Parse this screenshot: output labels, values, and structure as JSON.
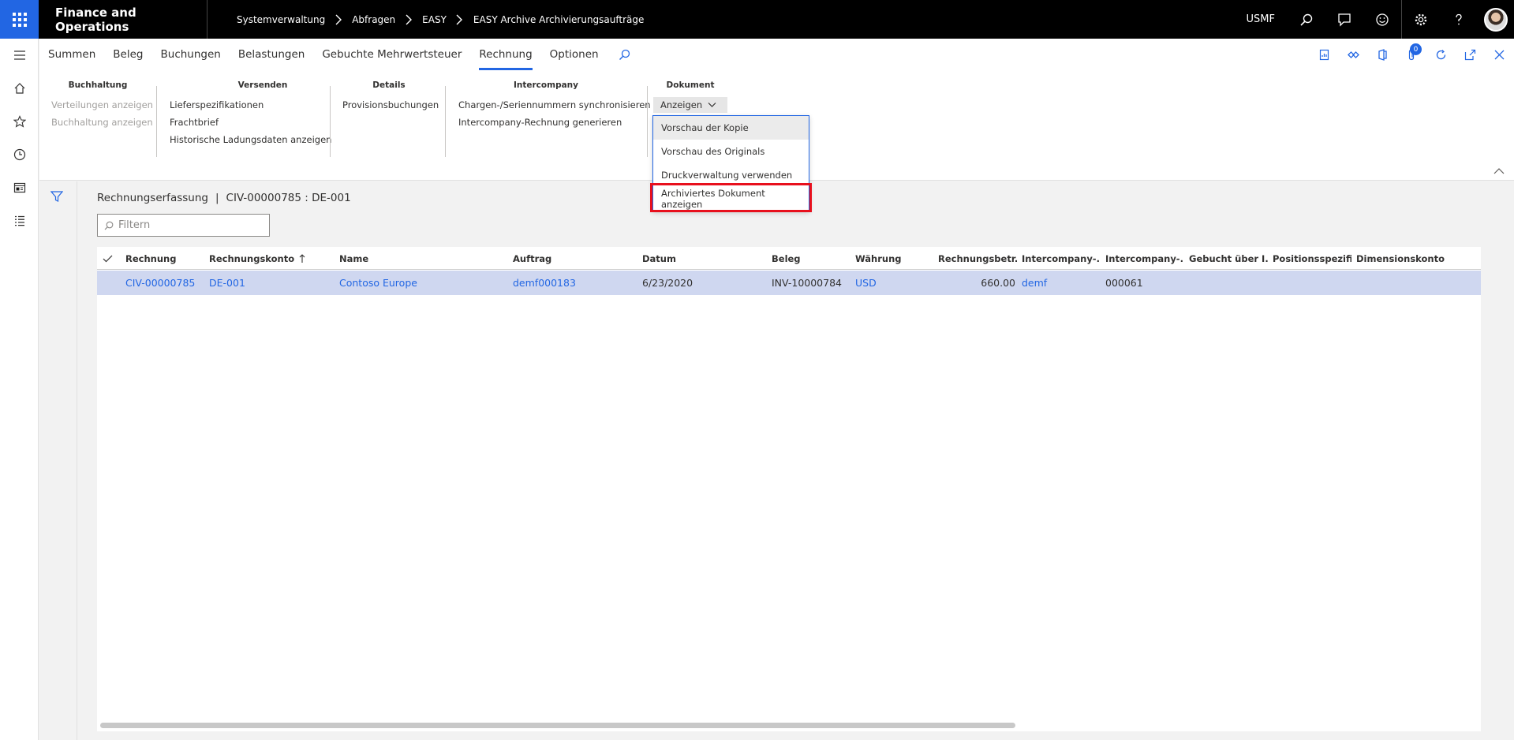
{
  "app": {
    "title": "Finance and Operations"
  },
  "breadcrumbs": [
    "Systemverwaltung",
    "Abfragen",
    "EASY",
    "EASY Archive Archivierungsaufträge"
  ],
  "topbar": {
    "company": "USMF"
  },
  "tabs": [
    "Summen",
    "Beleg",
    "Buchungen",
    "Belastungen",
    "Gebuchte Mehrwertsteuer",
    "Rechnung",
    "Optionen"
  ],
  "active_tab": "Rechnung",
  "notification_count": "0",
  "ribbon": {
    "buchhaltung": {
      "title": "Buchhaltung",
      "items": [
        "Verteilungen anzeigen",
        "Buchhaltung anzeigen"
      ]
    },
    "versenden": {
      "title": "Versenden",
      "items": [
        "Lieferspezifikationen",
        "Frachtbrief",
        "Historische Ladungsdaten anzeigen"
      ]
    },
    "details": {
      "title": "Details",
      "items": [
        "Provisionsbuchungen"
      ]
    },
    "intercompany": {
      "title": "Intercompany",
      "items": [
        "Chargen-/Seriennummern synchronisieren",
        "Intercompany-Rechnung generieren"
      ]
    },
    "dokument": {
      "title": "Dokument",
      "button": "Anzeigen"
    }
  },
  "dropdown": {
    "items": [
      "Vorschau der Kopie",
      "Vorschau des Originals",
      "Druckverwaltung verwenden",
      "Archiviertes Dokument anzeigen"
    ]
  },
  "page": {
    "caption_left": "Rechnungserfassung",
    "caption_right": "CIV-00000785 : DE-001",
    "filter_placeholder": "Filtern"
  },
  "grid": {
    "columns": [
      "Rechnung",
      "Rechnungskonto",
      "Name",
      "Auftrag",
      "Datum",
      "Beleg",
      "Währung",
      "Rechnungsbetr...",
      "Intercompany-...",
      "Intercompany-...",
      "Gebucht über I...",
      "Positionsspezifi...",
      "Dimensionskonto"
    ],
    "rows": [
      [
        "CIV-00000785",
        "DE-001",
        "Contoso Europe",
        "demf000183",
        "6/23/2020",
        "INV-10000784",
        "USD",
        "660.00",
        "demf",
        "000061",
        "",
        "",
        ""
      ]
    ]
  },
  "colors": {
    "accent": "#2266e3",
    "highlight": "#e8101d",
    "selected_row": "#cfd7f0"
  }
}
